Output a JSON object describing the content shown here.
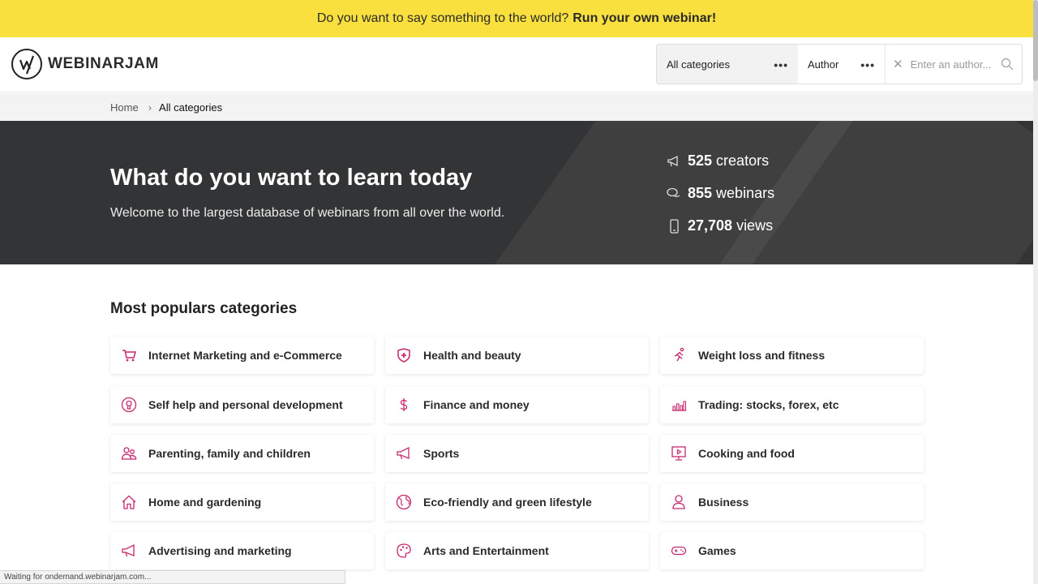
{
  "promo": {
    "question": "Do you want to say something to the world?",
    "cta": "Run your own webinar!"
  },
  "brand": {
    "name": "WEBINARJAM"
  },
  "filter": {
    "category": "All categories",
    "author": "Author",
    "search_placeholder": "Enter an author..."
  },
  "breadcrumb": {
    "home": "Home",
    "current": "All categories"
  },
  "hero": {
    "title": "What do you want to learn today",
    "subtitle": "Welcome to the largest database of webinars from all over the world.",
    "stats": [
      {
        "value": "525",
        "label": "creators",
        "icon": "megaphone-icon"
      },
      {
        "value": "855",
        "label": "webinars",
        "icon": "chat-bubbles-icon"
      },
      {
        "value": "27,708",
        "label": "views",
        "icon": "phone-icon"
      }
    ]
  },
  "categories": {
    "title": "Most populars categories",
    "items": [
      {
        "label": "Internet Marketing and e-Commerce",
        "icon": "cart-icon"
      },
      {
        "label": "Health and beauty",
        "icon": "shield-plus-icon"
      },
      {
        "label": "Weight loss and fitness",
        "icon": "running-icon"
      },
      {
        "label": "Self help and personal development",
        "icon": "lightbulb-icon"
      },
      {
        "label": "Finance and money",
        "icon": "dollar-icon"
      },
      {
        "label": "Trading: stocks, forex, etc",
        "icon": "bar-chart-icon"
      },
      {
        "label": "Parenting, family and children",
        "icon": "family-icon"
      },
      {
        "label": "Sports",
        "icon": "megaphone-icon"
      },
      {
        "label": "Cooking and food",
        "icon": "video-screen-icon"
      },
      {
        "label": "Home and gardening",
        "icon": "house-icon"
      },
      {
        "label": "Eco-friendly and green lifestyle",
        "icon": "globe-icon"
      },
      {
        "label": "Business",
        "icon": "person-icon"
      },
      {
        "label": "Advertising and marketing",
        "icon": "megaphone-icon"
      },
      {
        "label": "Arts and Entertainment",
        "icon": "palette-icon"
      },
      {
        "label": "Games",
        "icon": "gamepad-icon"
      }
    ]
  },
  "status_bar": "Waiting for ondemand.webinarjam.com...",
  "colors": {
    "promo_bg": "#f9e03f",
    "hero_bg": "#333435",
    "accent": "#c8286e"
  }
}
